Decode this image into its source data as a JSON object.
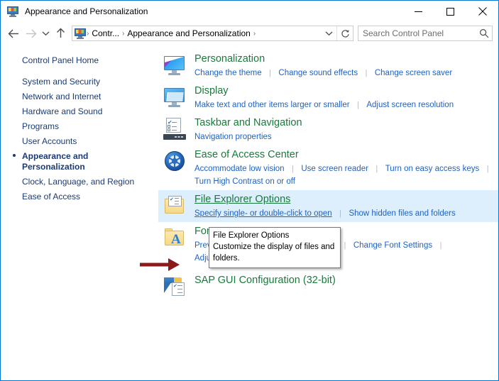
{
  "window": {
    "title": "Appearance and Personalization",
    "icon": "control-panel-icon",
    "minimize_label": "Minimize",
    "maximize_label": "Maximize",
    "close_label": "Close"
  },
  "navbar": {
    "back_label": "Back",
    "forward_label": "Forward",
    "recent_label": "Recent locations",
    "up_label": "Up",
    "breadcrumbs": [
      {
        "label": "Contr..."
      },
      {
        "label": "Appearance and Personalization"
      }
    ],
    "separator": "›",
    "dropdown_label": "Previous locations",
    "refresh_label": "Refresh"
  },
  "search": {
    "placeholder": "Search Control Panel",
    "value": "",
    "icon": "search-icon"
  },
  "sidebar": {
    "home": "Control Panel Home",
    "items": [
      {
        "label": "System and Security",
        "current": false
      },
      {
        "label": "Network and Internet",
        "current": false
      },
      {
        "label": "Hardware and Sound",
        "current": false
      },
      {
        "label": "Programs",
        "current": false
      },
      {
        "label": "User Accounts",
        "current": false
      },
      {
        "label": "Appearance and Personalization",
        "current": true
      },
      {
        "label": "Clock, Language, and Region",
        "current": false
      },
      {
        "label": "Ease of Access",
        "current": false
      }
    ]
  },
  "categories": [
    {
      "title": "Personalization",
      "icon": "personalization-monitor-icon",
      "links": [
        "Change the theme",
        "Change sound effects",
        "Change screen saver"
      ],
      "highlighted": false
    },
    {
      "title": "Display",
      "icon": "display-monitor-icon",
      "links": [
        "Make text and other items larger or smaller",
        "Adjust screen resolution"
      ],
      "highlighted": false
    },
    {
      "title": "Taskbar and Navigation",
      "icon": "taskbar-icon",
      "links": [
        "Navigation properties"
      ],
      "highlighted": false
    },
    {
      "title": "Ease of Access Center",
      "icon": "ease-of-access-icon",
      "links": [
        "Accommodate low vision",
        "Use screen reader",
        "Turn on easy access keys",
        "Turn High Contrast on or off"
      ],
      "highlighted": false
    },
    {
      "title": "File Explorer Options",
      "icon": "file-explorer-options-icon",
      "links": [
        "Specify single- or double-click to open",
        "Show hidden files and folders"
      ],
      "highlighted": true
    },
    {
      "title": "Fonts",
      "icon": "fonts-folder-icon",
      "links": [
        "Preview, delete, or show and hide fonts",
        "Change Font Settings",
        "Adjust ClearType text"
      ],
      "highlighted": false
    },
    {
      "title": "SAP GUI Configuration (32-bit)",
      "icon": "sap-gui-configuration-icon",
      "links": [],
      "highlighted": false
    }
  ],
  "tooltip": {
    "title": "File Explorer Options",
    "description": "Customize the display of files and folders."
  },
  "annotation": {
    "arrow": "red-arrow-pointing-right",
    "color": "#8b1a1a"
  },
  "colors": {
    "accent": "#0078d7",
    "heading": "#1a7a3c",
    "link": "#1f62c4",
    "sidebar_link": "#1a3b73",
    "highlight_row": "#ddeefc"
  }
}
